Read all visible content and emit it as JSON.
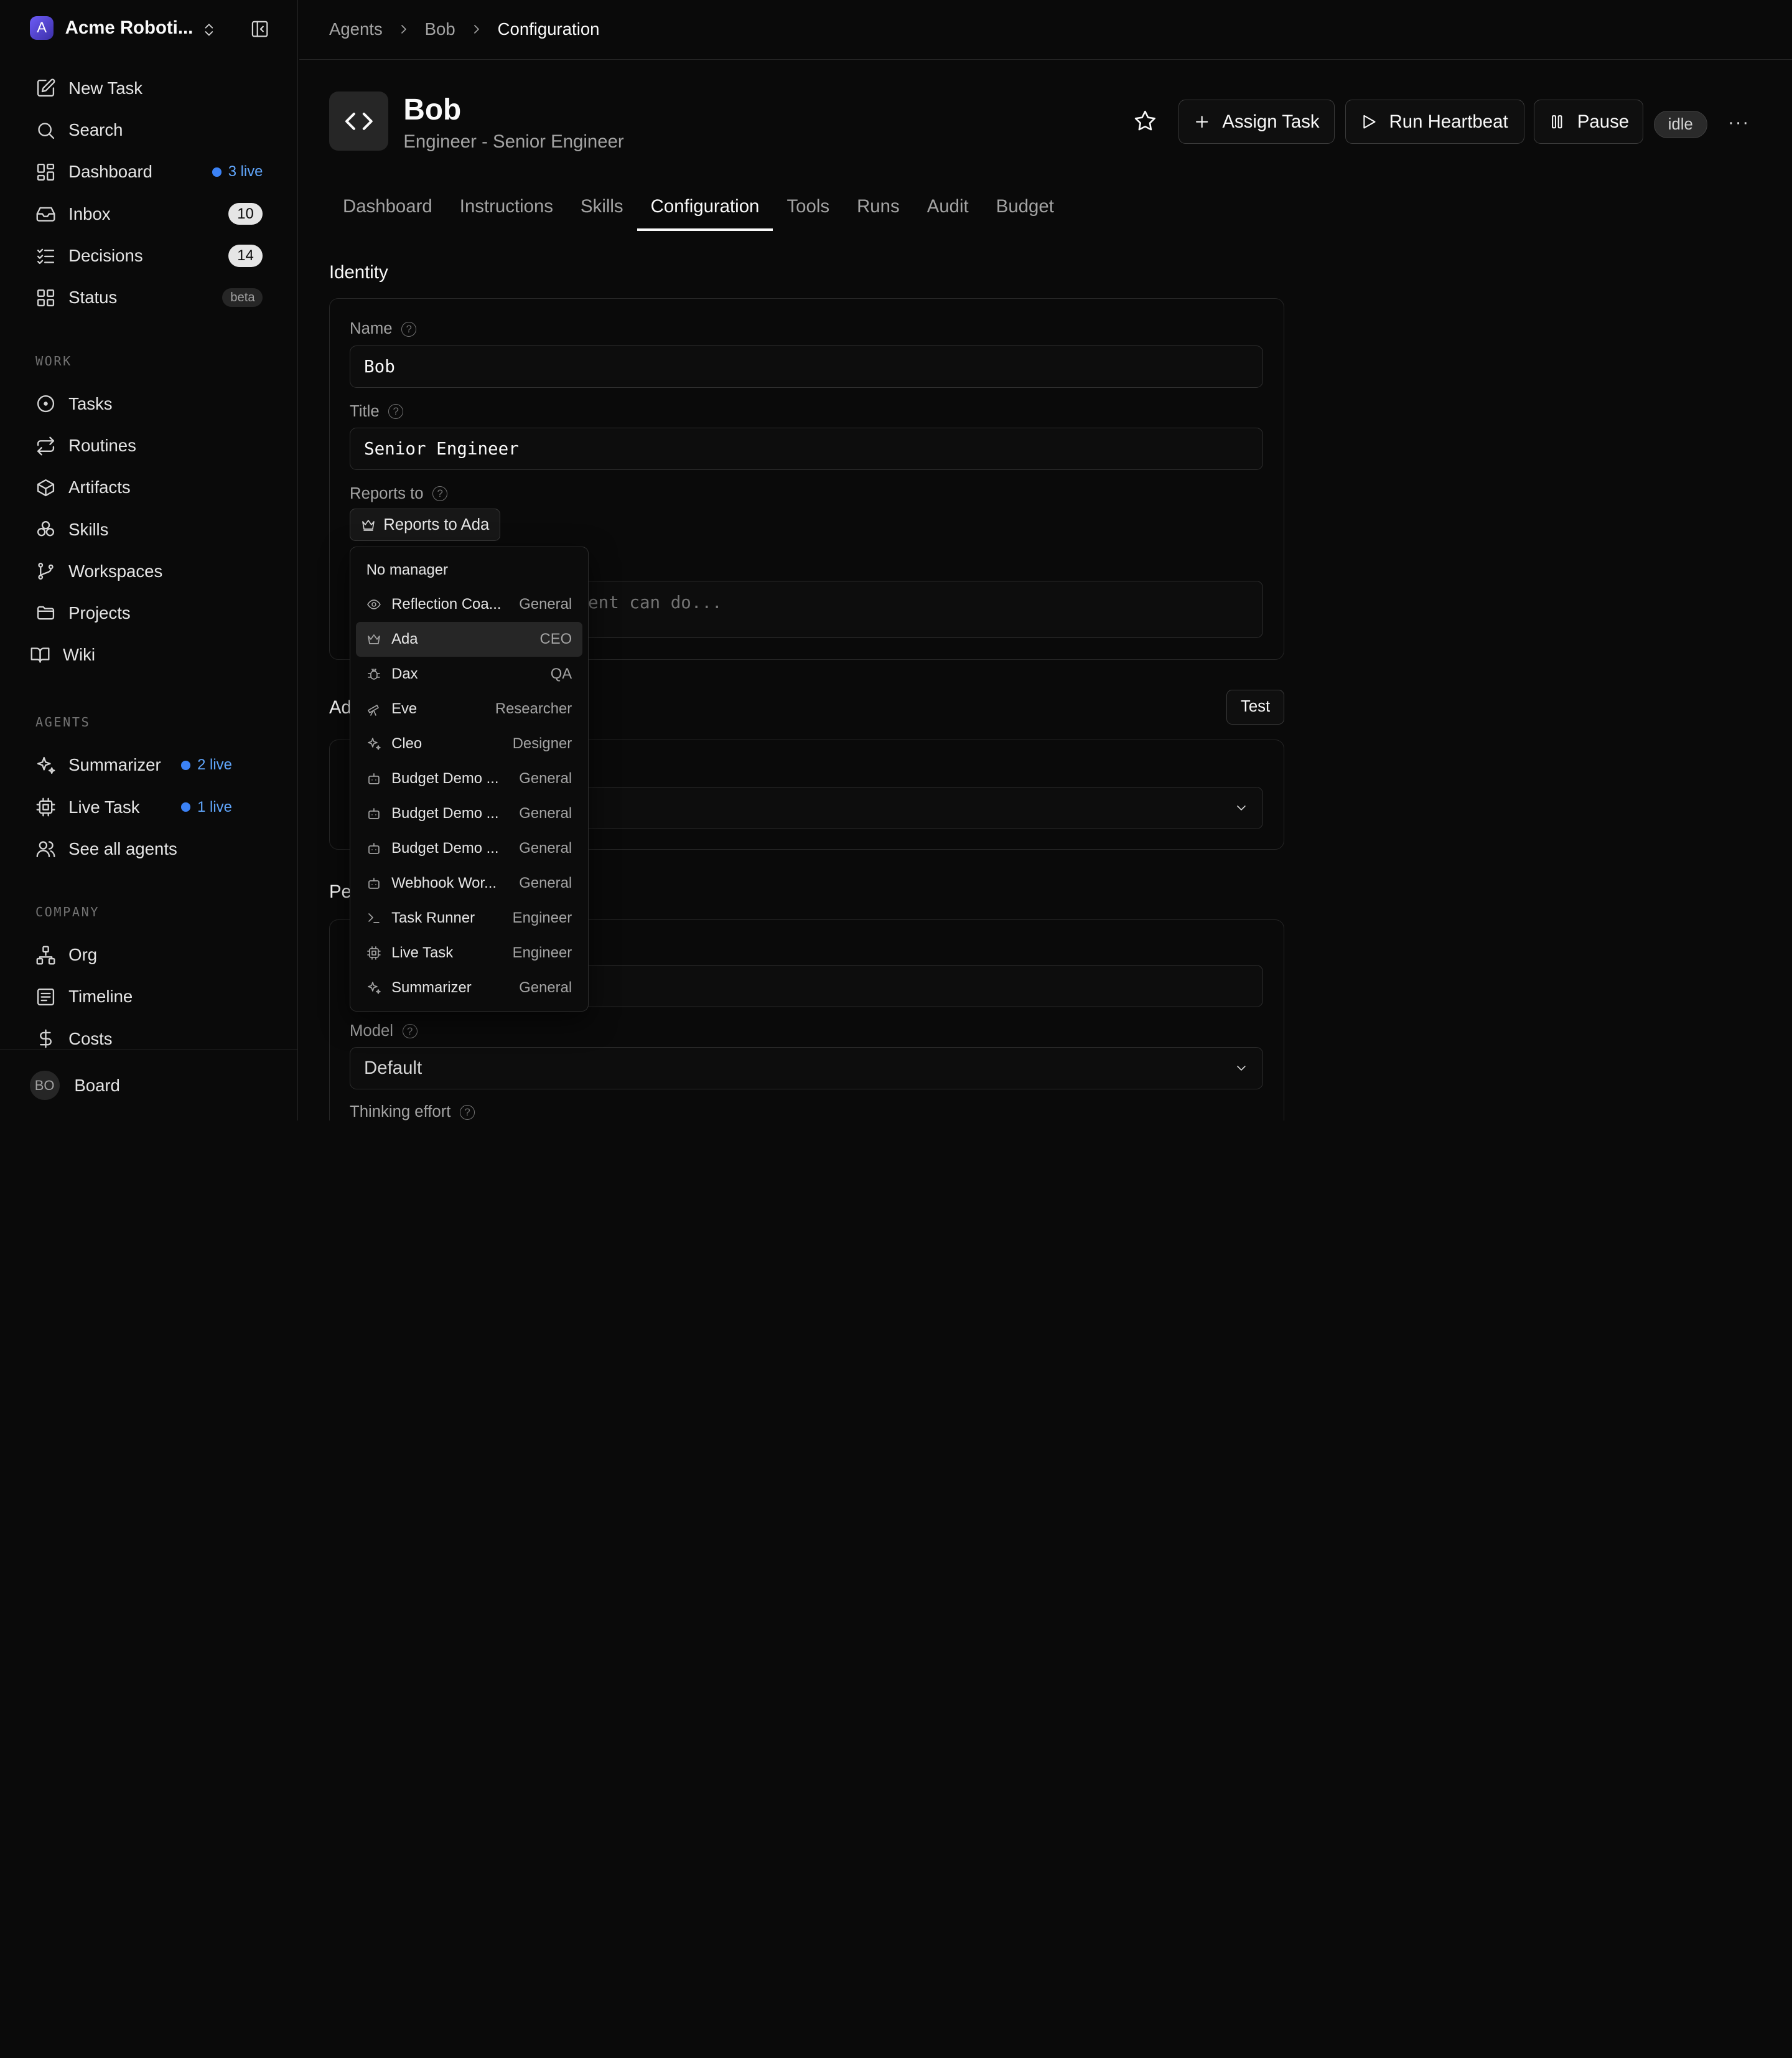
{
  "sidebar": {
    "company": {
      "logo_letter": "A",
      "name": "Acme Roboti..."
    },
    "top_items": [
      {
        "label": "New Task",
        "icon": "edit-icon"
      },
      {
        "label": "Search",
        "icon": "search-icon"
      },
      {
        "label": "Dashboard",
        "icon": "grid-icon",
        "live": "3 live"
      },
      {
        "label": "Inbox",
        "icon": "inbox-icon",
        "count": "10"
      },
      {
        "label": "Decisions",
        "icon": "list-checks-icon",
        "count": "14"
      },
      {
        "label": "Status",
        "icon": "grid-icon",
        "beta": "beta"
      }
    ],
    "work_label": "WORK",
    "work_items": [
      {
        "label": "Tasks",
        "icon": "circle-dot-icon"
      },
      {
        "label": "Routines",
        "icon": "repeat-icon"
      },
      {
        "label": "Artifacts",
        "icon": "box-icon"
      },
      {
        "label": "Skills",
        "icon": "boxes-icon"
      },
      {
        "label": "Workspaces",
        "icon": "git-branch-icon"
      },
      {
        "label": "Projects",
        "icon": "folder-icon"
      },
      {
        "label": "Wiki",
        "icon": "book-icon"
      }
    ],
    "agents_label": "AGENTS",
    "agent_items": [
      {
        "label": "Summarizer",
        "icon": "sparkles-icon",
        "live": "2 live"
      },
      {
        "label": "Live Task",
        "icon": "cpu-icon",
        "live": "1 live"
      },
      {
        "label": "See all agents",
        "icon": "users-icon"
      }
    ],
    "company_label": "COMPANY",
    "company_items": [
      {
        "label": "Org",
        "icon": "network-icon"
      },
      {
        "label": "Timeline",
        "icon": "timeline-icon"
      },
      {
        "label": "Costs",
        "icon": "dollar-icon"
      }
    ],
    "board": {
      "avatar": "BO",
      "label": "Board"
    }
  },
  "breadcrumb": [
    "Agents",
    "Bob",
    "Configuration"
  ],
  "agent": {
    "name": "Bob",
    "subtitle": "Engineer - Senior Engineer",
    "status": "idle"
  },
  "actions": {
    "assign": "Assign Task",
    "heartbeat": "Run Heartbeat",
    "pause": "Pause",
    "more": "···"
  },
  "tabs": [
    "Dashboard",
    "Instructions",
    "Skills",
    "Configuration",
    "Tools",
    "Runs",
    "Audit",
    "Budget"
  ],
  "active_tab": "Configuration",
  "identity": {
    "title": "Identity",
    "name_label": "Name",
    "name_value": "Bob",
    "title_label": "Title",
    "title_value": "Senior Engineer",
    "reports_label": "Reports to",
    "reports_value": "Reports to Ada",
    "capabilities_placeholder_visible": "ent can do..."
  },
  "adapter": {
    "title_visible": "Ad",
    "test_label": "Test"
  },
  "permissions": {
    "title_visible": "Pe",
    "model_label": "Model",
    "model_value": "Default",
    "thinking_label": "Thinking effort"
  },
  "dropdown": {
    "none_label": "No manager",
    "options": [
      {
        "name": "Reflection Coa...",
        "role": "General",
        "icon": "eye-icon"
      },
      {
        "name": "Ada",
        "role": "CEO",
        "icon": "crown-icon",
        "highlighted": true
      },
      {
        "name": "Dax",
        "role": "QA",
        "icon": "bug-icon"
      },
      {
        "name": "Eve",
        "role": "Researcher",
        "icon": "telescope-icon"
      },
      {
        "name": "Cleo",
        "role": "Designer",
        "icon": "sparkles-icon"
      },
      {
        "name": "Budget Demo ...",
        "role": "General",
        "icon": "bot-icon"
      },
      {
        "name": "Budget Demo ...",
        "role": "General",
        "icon": "bot-icon"
      },
      {
        "name": "Budget Demo ...",
        "role": "General",
        "icon": "bot-icon"
      },
      {
        "name": "Webhook Wor...",
        "role": "General",
        "icon": "bot-icon"
      },
      {
        "name": "Task Runner",
        "role": "Engineer",
        "icon": "terminal-icon"
      },
      {
        "name": "Live Task",
        "role": "Engineer",
        "icon": "cpu-icon"
      },
      {
        "name": "Summarizer",
        "role": "General",
        "icon": "sparkles-icon"
      }
    ]
  }
}
